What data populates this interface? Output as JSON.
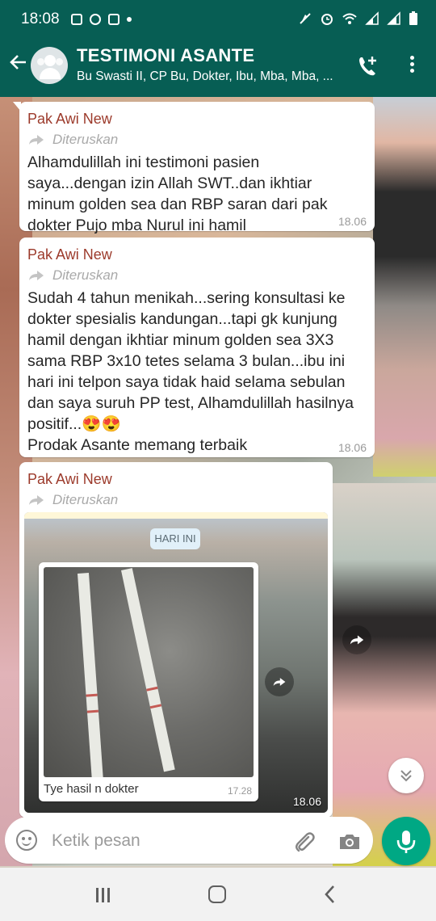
{
  "status_bar": {
    "time": "18:08"
  },
  "header": {
    "title": "TESTIMONI ASANTE",
    "subtitle": "Bu Swasti II, CP Bu, Dokter, Ibu, Mba, Mba, ..."
  },
  "messages": [
    {
      "sender": "Pak Awi New",
      "forwarded_label": "Diteruskan",
      "text": "Alhamdulillah ini testimoni pasien saya...dengan izin Allah SWT..dan ikhtiar minum golden sea dan RBP saran dari pak dokter Pujo mba Nurul ini hamil",
      "time": "18.06"
    },
    {
      "sender": "Pak Awi New",
      "forwarded_label": "Diteruskan",
      "text": "Sudah 4 tahun menikah...sering konsultasi ke dokter spesialis kandungan...tapi gk kunjung hamil dengan ikhtiar minum golden sea  3X3 sama RBP  3x10 tetes selama 3 bulan...ibu ini hari ini telpon saya tidak haid selama sebulan dan saya suruh PP test, Alhamdulillah hasilnya positif...😍😍\nProdak Asante memang terbaik",
      "time": "18.06"
    },
    {
      "sender": "Pak Awi New",
      "forwarded_label": "Diteruskan",
      "image": {
        "date_pill": "HARI INI",
        "inner_caption": "Tye hasil n dokter",
        "inner_time": "17.28",
        "time": "18.06"
      }
    }
  ],
  "composer": {
    "placeholder": "Ketik pesan"
  },
  "colors": {
    "header_bg": "#075e54",
    "sender_name": "#9c3a2b",
    "mic_button": "#00a884",
    "bubble_bg": "#ffffff"
  },
  "icons": {
    "back": "arrow-left-icon",
    "call": "add-call-icon",
    "menu": "more-vertical-icon",
    "forward": "forward-icon",
    "share": "share-icon",
    "scroll": "chevron-double-down-icon",
    "emoji": "emoji-icon",
    "attach": "paperclip-icon",
    "camera": "camera-icon",
    "mic": "microphone-icon"
  }
}
